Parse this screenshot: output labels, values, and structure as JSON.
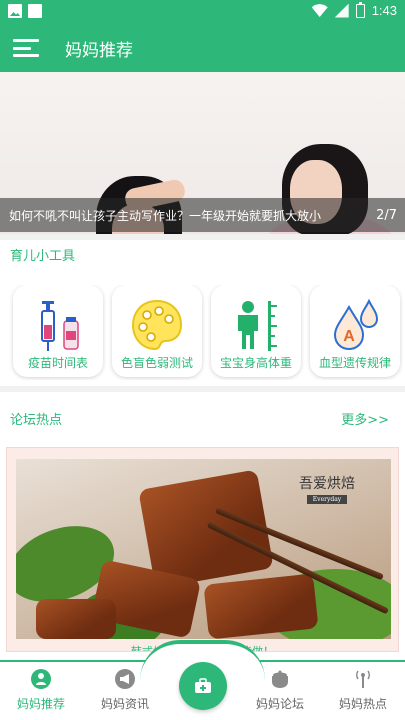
{
  "status_bar": {
    "time": "1:43"
  },
  "app_bar": {
    "title": "妈妈推荐"
  },
  "banner": {
    "caption": "如何不吼不叫让孩子主动写作业？一年级开始就要抓大放小",
    "index": "2/7"
  },
  "tools_section": {
    "title": "育儿小工具",
    "items": [
      {
        "label": "疫苗时间表",
        "icon": "vaccine-icon"
      },
      {
        "label": "色盲色弱测试",
        "icon": "palette-icon"
      },
      {
        "label": "宝宝身高体重",
        "icon": "height-icon"
      },
      {
        "label": "血型遗传规律",
        "icon": "blood-type-icon"
      }
    ]
  },
  "forum_section": {
    "title": "论坛热点",
    "more": "更多>>",
    "post_caption": "韩式烤五花肉，在家也能做！",
    "stamp": "吾爱烘焙",
    "stamp_sub": "Everyday"
  },
  "bottom_nav": {
    "items": [
      {
        "label": "妈妈推荐",
        "active": true
      },
      {
        "label": "妈妈资讯",
        "active": false
      },
      {
        "label": "妈妈论坛",
        "active": false
      },
      {
        "label": "妈妈热点",
        "active": false
      }
    ]
  },
  "colors": {
    "accent": "#2db87a"
  }
}
